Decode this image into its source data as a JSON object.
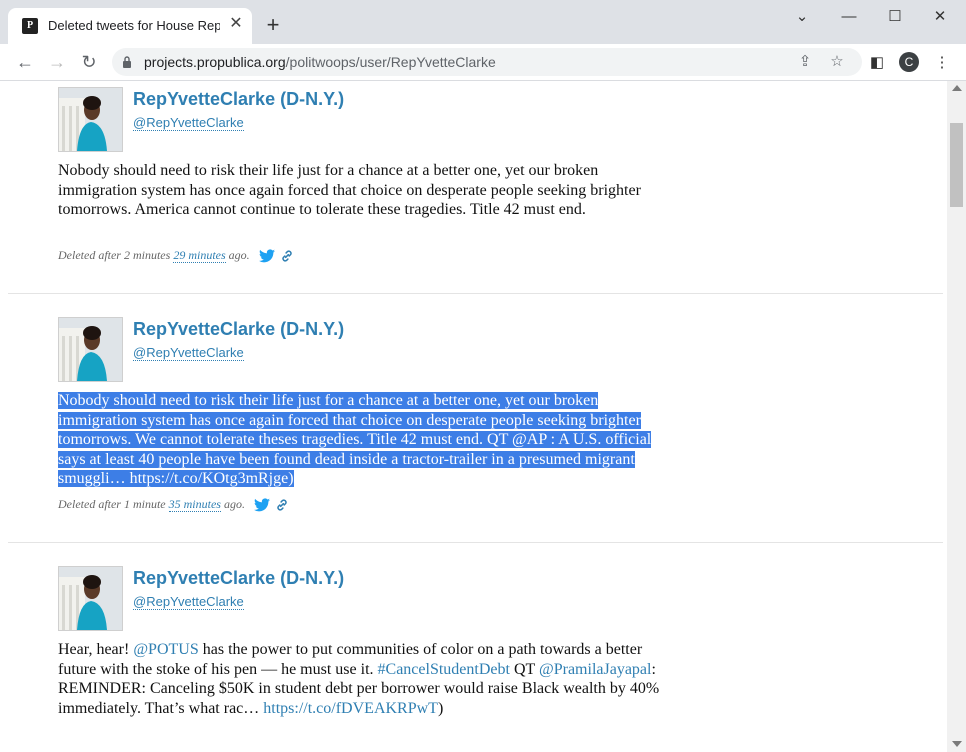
{
  "browser": {
    "tab_title": "Deleted tweets for House Represe",
    "url_domain": "projects.propublica.org",
    "url_path": "/politwoops/user/RepYvetteClarke",
    "profile_initial": "C"
  },
  "tweets": [
    {
      "name": "RepYvetteClarke (D-N.Y.)",
      "handle": "@RepYvetteClarke",
      "text": "Nobody should need to risk their life just for a chance at a better one, yet our broken immigration system has once again forced that choice on desperate people seeking brighter tomorrows. America cannot continue to tolerate these tragedies. Title 42 must end.",
      "meta_prefix": "Deleted after 2 minutes",
      "meta_rel": "29 minutes",
      "meta_suffix": "ago."
    },
    {
      "name": "RepYvetteClarke (D-N.Y.)",
      "handle": "@RepYvetteClarke",
      "text": "Nobody should need to risk their life just for a chance at a better one, yet our broken immigration system has once again forced that choice on desperate people seeking brighter tomorrows. We cannot tolerate theses tragedies. Title 42 must end. QT @AP : A U.S. official says at least 40 people have been found dead inside a tractor-trailer in a presumed migrant smuggli… https://t.co/KOtg3mRjge)",
      "meta_prefix": "Deleted after 1 minute",
      "meta_rel": "35 minutes",
      "meta_suffix": "ago."
    },
    {
      "name": "RepYvetteClarke (D-N.Y.)",
      "handle": "@RepYvetteClarke",
      "text_parts": {
        "a": "Hear, hear! ",
        "mention1": "@POTUS",
        "b": " has the power to put communities of color on a path towards a better future with the stoke of his pen — he must use it. ",
        "hashtag": "#CancelStudentDebt",
        "c": " QT ",
        "mention2": "@PramilaJayapal",
        "d": ": REMINDER: Canceling $50K in student debt per borrower would raise Black wealth by 40% immediately. That’s what rac…",
        "link": "https://t.co/fDVEAKRPwT",
        "e": ")"
      }
    }
  ],
  "colors": {
    "link": "#2f7fb2",
    "selection": "#3d7ee6",
    "twitter": "#1da1f2"
  }
}
